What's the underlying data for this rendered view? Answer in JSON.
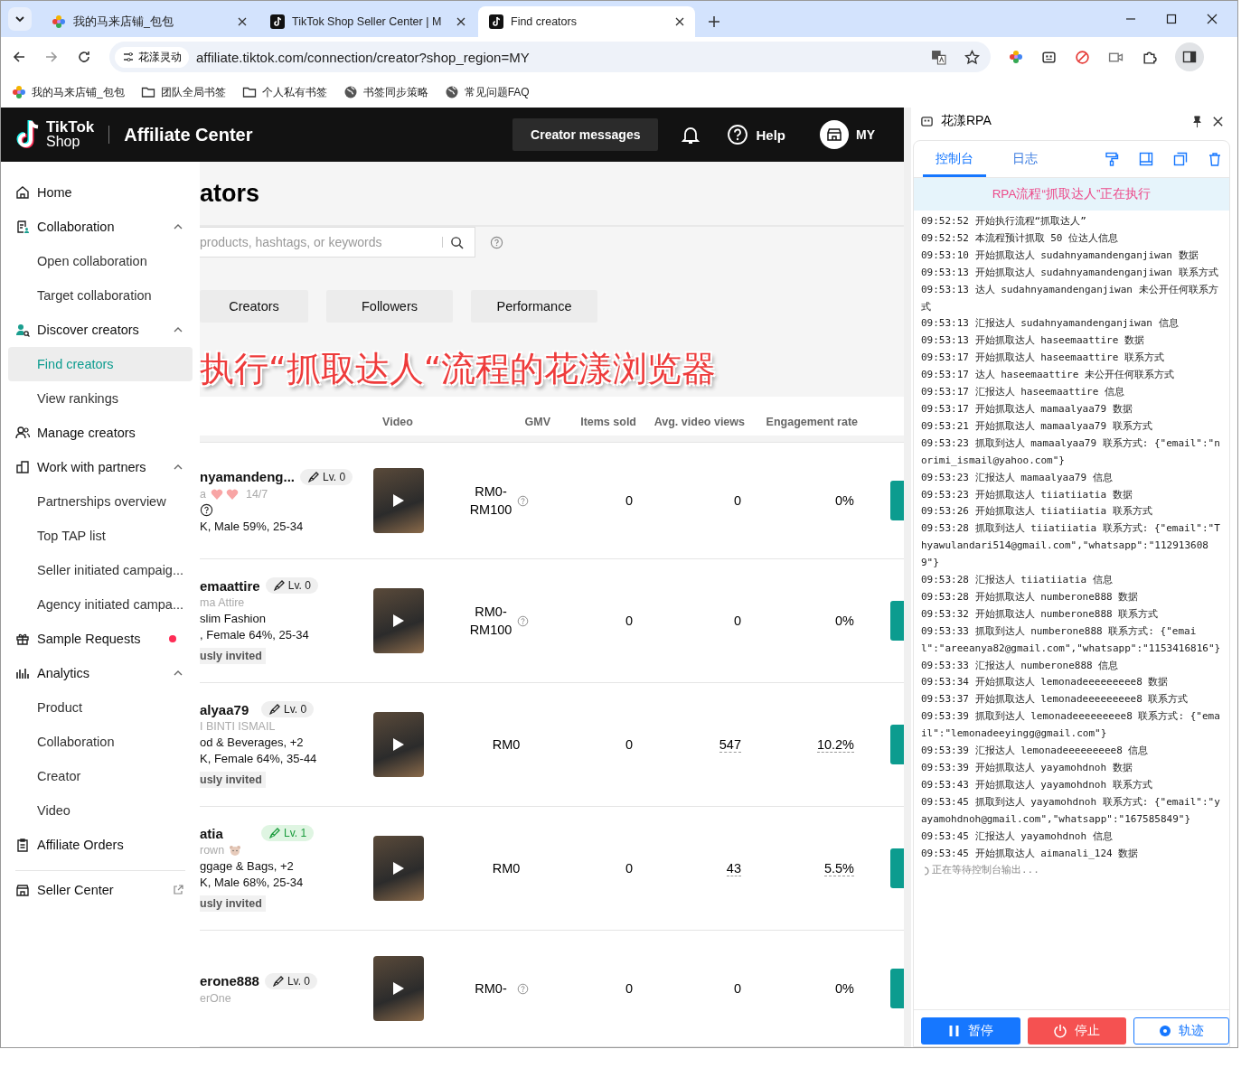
{
  "browser": {
    "tabs": [
      {
        "title": "我的马来店铺_包包",
        "selected": false,
        "kind": "flower"
      },
      {
        "title": "TikTok Shop Seller Center | M",
        "selected": false,
        "kind": "tiktok"
      },
      {
        "title": "Find creators",
        "selected": true,
        "kind": "tiktok"
      }
    ],
    "address": {
      "site_chip": "花漾灵动",
      "url": "affiliate.tiktok.com/connection/creator?shop_region=MY"
    },
    "bookmarks": [
      {
        "label": "我的马来店铺_包包",
        "kind": "flower"
      },
      {
        "label": "团队全局书签",
        "kind": "folder"
      },
      {
        "label": "个人私有书签",
        "kind": "folder"
      },
      {
        "label": "书签同步策略",
        "kind": "globe"
      },
      {
        "label": "常见问题FAQ",
        "kind": "globe"
      }
    ]
  },
  "header": {
    "brand_top": "TikTok",
    "brand_bottom": "Shop",
    "title": "Affiliate Center",
    "creator_messages": "Creator messages",
    "help": "Help",
    "account": "MY"
  },
  "sidebar": {
    "items": [
      {
        "label": "Home"
      },
      {
        "label": "Collaboration",
        "expanded": true,
        "children": [
          {
            "label": "Open collaboration",
            "selected": false
          },
          {
            "label": "Target collaboration",
            "selected": false
          }
        ]
      },
      {
        "label": "Discover creators",
        "expanded": true,
        "children": [
          {
            "label": "Find creators",
            "selected": true
          },
          {
            "label": "View rankings",
            "selected": false
          }
        ]
      },
      {
        "label": "Manage creators"
      },
      {
        "label": "Work with partners",
        "expanded": true,
        "children": [
          {
            "label": "Partnerships overview",
            "selected": false
          },
          {
            "label": "Top TAP list",
            "selected": false
          },
          {
            "label": "Seller initiated campaig...",
            "selected": false
          },
          {
            "label": "Agency initiated campa...",
            "selected": false
          }
        ]
      },
      {
        "label": "Sample Requests",
        "dot": true
      },
      {
        "label": "Analytics",
        "expanded": true,
        "children": [
          {
            "label": "Product",
            "selected": false
          },
          {
            "label": "Collaboration",
            "selected": false
          },
          {
            "label": "Creator",
            "selected": false
          },
          {
            "label": "Video",
            "selected": false
          }
        ]
      },
      {
        "label": "Affiliate Orders"
      }
    ],
    "footer_items": [
      {
        "label": "Seller Center",
        "external": true
      }
    ]
  },
  "content": {
    "page_title": "ators",
    "search": {
      "placeholder": "products, hashtags, or keywords"
    },
    "filter_tabs": [
      "Creators",
      "Followers",
      "Performance"
    ],
    "overlay_caption": "执行“抓取达人“流程的花漾浏览器",
    "columns": [
      "Video",
      "GMV",
      "Items sold",
      "Avg. video views",
      "Engagement rate"
    ],
    "rows": [
      {
        "name": "nyamandeng...",
        "level": "Lv. 0",
        "level_highlighted": false,
        "subtitle": "a",
        "hearts": true,
        "date": "14/7",
        "info_icon": true,
        "demographics": "K, Male 59%, 25-34",
        "gmv": "RM0-RM100",
        "gmv_help": true,
        "items_sold": "0",
        "avg_views": "0",
        "engagement": "0%",
        "detailed": false
      },
      {
        "name": "emaattire",
        "level": "Lv. 0",
        "level_highlighted": false,
        "subtitle": "ma Attire",
        "category": "slim Fashion",
        "demographics": ", Female 64%, 25-34",
        "invited": "usly invited",
        "gmv": "RM0-RM100",
        "gmv_help": true,
        "items_sold": "0",
        "avg_views": "0",
        "engagement": "0%",
        "detailed": false
      },
      {
        "name": "alyaa79",
        "level": "Lv. 0",
        "level_highlighted": false,
        "subtitle": "I BINTI ISMAIL",
        "category": "od & Beverages, +2",
        "demographics": "K, Female 64%, 35-44",
        "invited": "usly invited",
        "gmv": "RM0",
        "gmv_help": false,
        "items_sold": "0",
        "avg_views": "547",
        "engagement": "10.2%",
        "detailed": true
      },
      {
        "name": "atia",
        "level": "Lv. 1",
        "level_highlighted": true,
        "subtitle": "rown",
        "bear_icon": true,
        "category": "ggage & Bags, +2",
        "demographics": "K, Male 68%, 25-34",
        "invited": "usly invited",
        "gmv": "RM0",
        "gmv_help": false,
        "items_sold": "0",
        "avg_views": "43",
        "engagement": "5.5%",
        "detailed": true
      },
      {
        "name": "erone888",
        "level": "Lv. 0",
        "level_highlighted": false,
        "subtitle": "erOne",
        "gmv": "RM0-",
        "gmv_help": true,
        "items_sold": "0",
        "avg_views": "0",
        "engagement": "0%",
        "detailed": false
      }
    ]
  },
  "rpa": {
    "title": "花漾RPA",
    "tabs": [
      {
        "label": "控制台",
        "selected": true
      },
      {
        "label": "日志",
        "selected": false
      }
    ],
    "banner": "RPA流程“抓取达人”正在执行",
    "logs": [
      "09:52:52 开始执行流程“抓取达人”",
      "09:52:52 本流程预计抓取 50 位达人信息",
      "09:53:10 开始抓取达人 sudahnyamandenganjiwan 数据",
      "09:53:13 开始抓取达人 sudahnyamandenganjiwan 联系方式",
      "09:53:13 达人 sudahnyamandenganjiwan 未公开任何联系方式",
      "09:53:13 汇报达人 sudahnyamandenganjiwan 信息",
      "09:53:13 开始抓取达人 haseemaattire 数据",
      "09:53:17 开始抓取达人 haseemaattire 联系方式",
      "09:53:17 达人 haseemaattire 未公开任何联系方式",
      "09:53:17 汇报达人 haseemaattire 信息",
      "09:53:17 开始抓取达人 mamaalyaa79 数据",
      "09:53:21 开始抓取达人 mamaalyaa79 联系方式",
      "09:53:23 抓取到达人 mamaalyaa79 联系方式: {\"email\":\"norimi_ismail@yahoo.com\"}",
      "09:53:23 汇报达人 mamaalyaa79 信息",
      "09:53:23 开始抓取达人 tiiatiiatia 数据",
      "09:53:26 开始抓取达人 tiiatiiatia 联系方式",
      "09:53:28 抓取到达人 tiiatiiatia 联系方式: {\"email\":\"Thyawulandari514@gmail.com\",\"whatsapp\":\"1129136089\"}",
      "09:53:28 汇报达人 tiiatiiatia 信息",
      "09:53:28 开始抓取达人 numberone888 数据",
      "09:53:32 开始抓取达人 numberone888 联系方式",
      "09:53:33 抓取到达人 numberone888 联系方式: {\"email\":\"areeanya82@gmail.com\",\"whatsapp\":\"1153416816\"}",
      "09:53:33 汇报达人 numberone888 信息",
      "09:53:34 开始抓取达人 lemonadeeeeeeeee8 数据",
      "09:53:37 开始抓取达人 lemonadeeeeeeeee8 联系方式",
      "09:53:39 抓取到达人 lemonadeeeeeeeee8 联系方式: {\"email\":\"lemonadeeyingg@gmail.com\"}",
      "09:53:39 汇报达人 lemonadeeeeeeeee8 信息",
      "09:53:39 开始抓取达人 yayamohdnoh 数据",
      "09:53:43 开始抓取达人 yayamohdnoh 联系方式",
      "09:53:45 抓取到达人 yayamohdnoh 联系方式: {\"email\":\"yayamohdnoh@gmail.com\",\"whatsapp\":\"167585849\"}",
      "09:53:45 汇报达人 yayamohdnoh 信息",
      "09:53:45 开始抓取达人 aimanali_124 数据"
    ],
    "waiting": "正在等待控制台输出...",
    "buttons": [
      {
        "label": "暂停",
        "kind": "pause"
      },
      {
        "label": "停止",
        "kind": "stop"
      },
      {
        "label": "轨迹",
        "kind": "track"
      }
    ]
  }
}
